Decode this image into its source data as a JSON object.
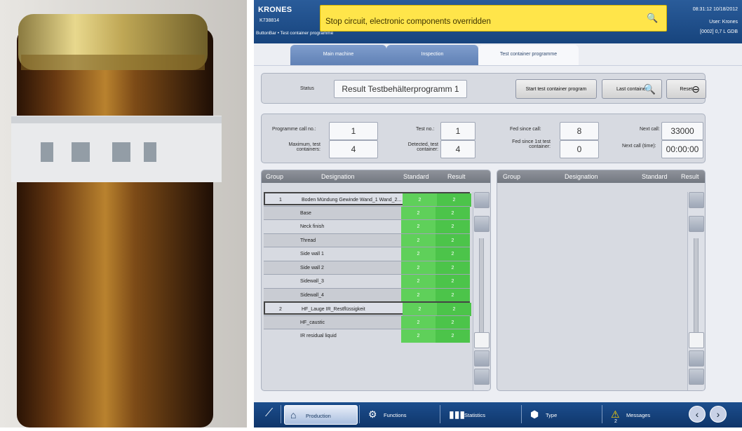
{
  "header": {
    "brand": "KRONES",
    "machine_id": "K738814",
    "alarm_text": "Stop circuit, electronic components overridden",
    "datetime": "08:31:12  10/18/2012",
    "user": "User: Krones",
    "product": "[0002]  0,7 L GDB",
    "breadcrumb": "ButtonBar • Test container programme"
  },
  "tabs": [
    "Main machine",
    "Inspection",
    "Test container programme"
  ],
  "status": {
    "label": "Status",
    "value": "Result Testbehälterprogramm 1",
    "btn_start": "Start test container program",
    "btn_last": "Last container",
    "btn_reset": "Reset"
  },
  "fields": {
    "prog_call_no_label": "Programme call no.:",
    "prog_call_no": "1",
    "max_test_label": "Maximum, test containers:",
    "max_test": "4",
    "test_no_label": "Test no.:",
    "test_no": "1",
    "detected_label": "Detected, test container:",
    "detected": "4",
    "fed_since_call_label": "Fed since call:",
    "fed_since_call": "8",
    "fed_since_first_label": "Fed since 1st test container:",
    "fed_since_first": "0",
    "next_call_label": "Next call:",
    "next_call": "33000",
    "next_call_time_label": "Next call (time):",
    "next_call_time": "00:00:00"
  },
  "table_left": {
    "headers": [
      "Group",
      "Designation",
      "Standard",
      "Result"
    ],
    "rows": [
      {
        "group": "1",
        "name": "Boden Mündung Gewinde Wand_1 Wand_2...",
        "std": "2",
        "res": "2",
        "header": true
      },
      {
        "group": "",
        "name": "Base",
        "std": "2",
        "res": "2"
      },
      {
        "group": "",
        "name": "Neck finish",
        "std": "2",
        "res": "2"
      },
      {
        "group": "",
        "name": "Thread",
        "std": "2",
        "res": "2"
      },
      {
        "group": "",
        "name": "Side wall 1",
        "std": "2",
        "res": "2"
      },
      {
        "group": "",
        "name": "Side wall 2",
        "std": "2",
        "res": "2"
      },
      {
        "group": "",
        "name": "Sidewall_3",
        "std": "2",
        "res": "2"
      },
      {
        "group": "",
        "name": "Sidewall_4",
        "std": "2",
        "res": "2"
      },
      {
        "group": "2",
        "name": "HF_Lauge IR_Restflüssigkeit",
        "std": "2",
        "res": "2",
        "header": true
      },
      {
        "group": "",
        "name": "HF_caustic",
        "std": "2",
        "res": "2"
      },
      {
        "group": "",
        "name": "IR residual liquid",
        "std": "2",
        "res": "2"
      }
    ]
  },
  "table_right": {
    "headers": [
      "Group",
      "Designation",
      "Standard",
      "Result"
    ]
  },
  "bottom": {
    "production": "Production",
    "functions": "Functions",
    "statistics": "Statistics",
    "type": "Type",
    "messages": "Messages",
    "messages_count": "2"
  }
}
